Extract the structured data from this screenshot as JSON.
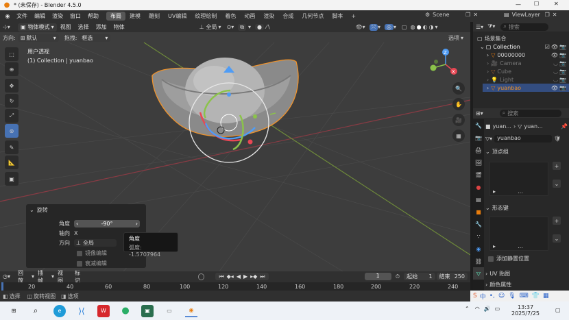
{
  "window": {
    "title": "* (未保存) - Blender 4.5.0"
  },
  "menu": {
    "items": [
      "文件",
      "编辑",
      "渲染",
      "窗口",
      "帮助"
    ]
  },
  "workspaces": [
    "布局",
    "建模",
    "雕刻",
    "UV编辑",
    "纹理绘制",
    "着色",
    "动画",
    "渲染",
    "合成",
    "几何节点",
    "脚本"
  ],
  "scene": {
    "label": "Scene",
    "viewlayer": "ViewLayer"
  },
  "viewport_header": {
    "mode": "物体模式",
    "menus": [
      "视图",
      "选择",
      "添加",
      "物体"
    ],
    "orientation": "全局",
    "direction_label": "方向:",
    "direction_value": "默认",
    "drag_label": "拖拽:",
    "drag_value": "框选",
    "options": "选项"
  },
  "viewport": {
    "view_name": "用户透视",
    "collection_info": "(1) Collection | yuanbao"
  },
  "gizmo": {
    "x": "X",
    "y": "Y",
    "z": "Z"
  },
  "redo_panel": {
    "title": "旋转",
    "angle_label": "角度",
    "angle_value": "-90°",
    "axis_label": "轴向",
    "axis_value": "X",
    "orient_label": "方向",
    "orient_value": "全局",
    "mirror": "镜像编辑",
    "falloff": "衰减编辑"
  },
  "tooltip": {
    "title": "角度",
    "radians": "弧度: -1.5707964"
  },
  "outliner": {
    "search_placeholder": "搜索",
    "root": "场景集合",
    "collection": "Collection",
    "objects": [
      "00000000",
      "Camera",
      "Cube",
      "Light",
      "yuanbao"
    ]
  },
  "properties": {
    "search_placeholder": "搜索",
    "breadcrumb_a": "yuan...",
    "breadcrumb_b": "yuan...",
    "mesh_name": "yuanbao",
    "vertex_groups": "顶点组",
    "shape_keys": "形态键",
    "add_rest_pos": "添加静置位置",
    "uv_maps": "UV 贴图",
    "color_attr": "颜色属性"
  },
  "timeline": {
    "menus": [
      "回放",
      "插帧",
      "视图",
      "标记"
    ],
    "current_frame": "1",
    "start_label": "起始",
    "start_value": "1",
    "end_label": "结束",
    "end_value": "250",
    "ticks": [
      "20",
      "40",
      "60",
      "80",
      "100",
      "120",
      "140",
      "160",
      "180",
      "200",
      "220",
      "240"
    ]
  },
  "statusbar": {
    "items": [
      "选择",
      "旋转视图",
      "选项"
    ]
  },
  "taskbar": {
    "time": "13:37",
    "date": "2025/7/25",
    "ime": "中"
  },
  "colors": {
    "accent": "#4772b3",
    "select_orange": "#f0932b",
    "x_red": "#e84754",
    "y_green": "#8bc34a",
    "z_blue": "#4f9cf5"
  }
}
